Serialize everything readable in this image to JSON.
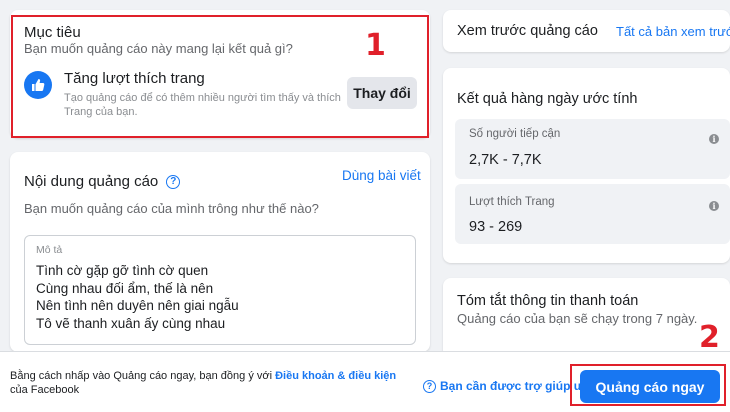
{
  "objective": {
    "heading": "Mục tiêu",
    "question": "Bạn muốn quảng cáo này mang lại kết quả gì?",
    "option_title": "Tăng lượt thích trang",
    "option_desc_1": "Tạo quảng cáo để có thêm nhiều người tìm thấy và thích",
    "option_desc_2": "Trang của bạn.",
    "change_label": "Thay đổi"
  },
  "content": {
    "heading": "Nội dung quảng cáo",
    "use_post_label": "Dùng bài viết",
    "question": "Bạn muốn quảng cáo của mình trông như thế nào?",
    "desc_label": "Mô tả",
    "desc_lines": [
      "Tình cờ gặp gỡ tình cờ quen",
      "Cùng nhau đối ẩm, thế là nên",
      "Nên tình nên duyên nên giai ngẫu",
      "Tô vẽ thanh xuân ấy cùng nhau"
    ]
  },
  "preview": {
    "heading": "Xem trước quảng cáo",
    "all_label": "Tất cả bản xem trước"
  },
  "estimate": {
    "heading": "Kết quả hàng ngày ước tính",
    "reach_label": "Số người tiếp cận",
    "reach_value": "2,7K - 7,7K",
    "likes_label": "Lượt thích Trang",
    "likes_value": "93 - 269"
  },
  "payment": {
    "heading": "Tóm tắt thông tin thanh toán",
    "desc": "Quảng cáo của bạn sẽ chạy trong 7 ngày."
  },
  "footer": {
    "terms_prefix": "Bằng cách nhấp vào Quảng cáo ngay, bạn đồng ý với ",
    "terms_link": "Điều khoản & điều kiện",
    "terms_suffix": "của Facebook",
    "help_label": "Bạn cần được trợ giúp ư?",
    "promote_label": "Quảng cáo ngay"
  },
  "annotations": {
    "one": "1",
    "two": "2"
  },
  "colors": {
    "accent": "#1877f2",
    "highlight": "#e0202a"
  }
}
